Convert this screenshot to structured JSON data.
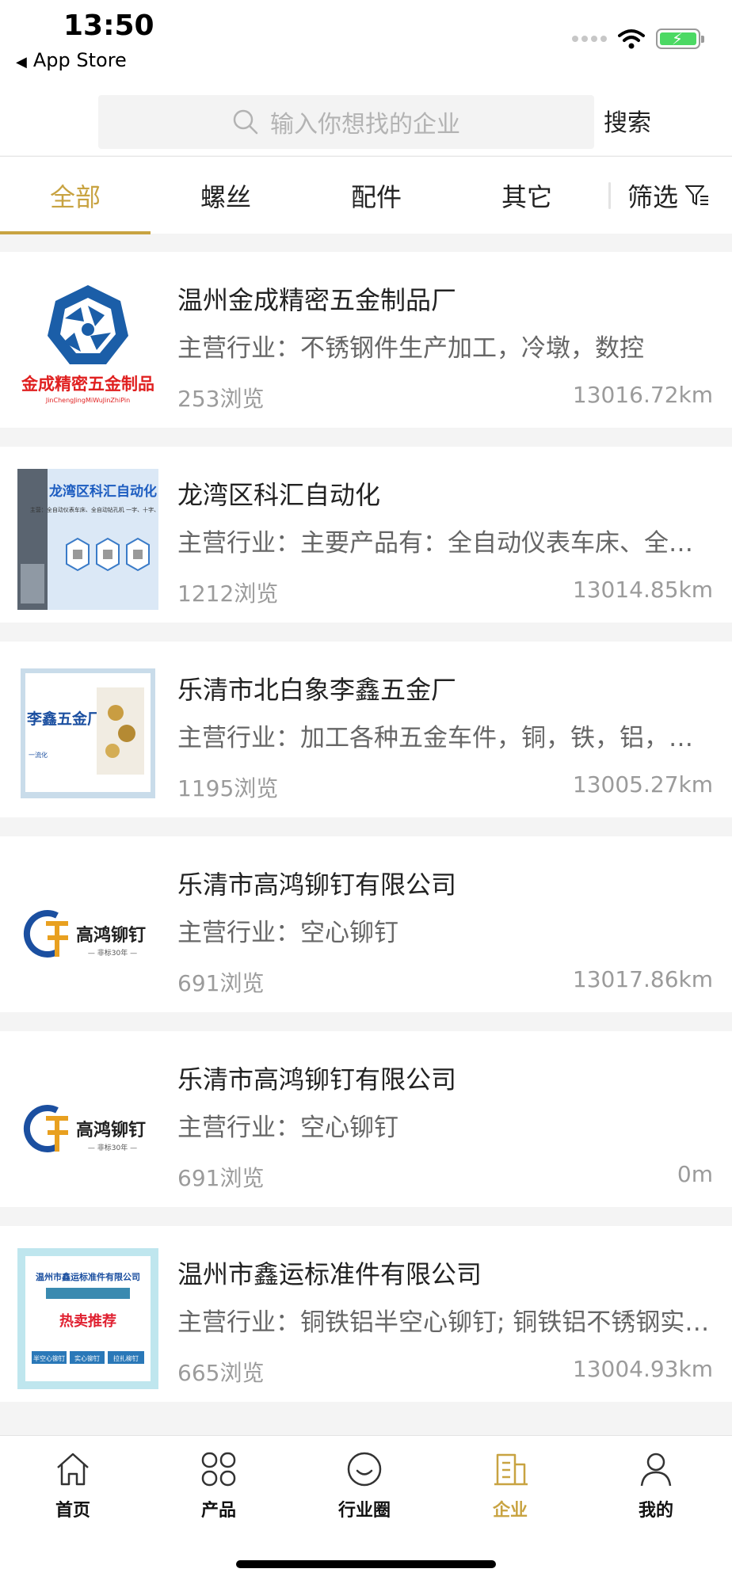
{
  "status_bar": {
    "time": "13:50",
    "back_label": "App Store"
  },
  "search": {
    "placeholder": "输入你想找的企业",
    "button_label": "搜索"
  },
  "tabs": [
    {
      "label": "全部",
      "active": true
    },
    {
      "label": "螺丝",
      "active": false
    },
    {
      "label": "配件",
      "active": false
    },
    {
      "label": "其它",
      "active": false
    }
  ],
  "filter_label": "筛选",
  "companies": [
    {
      "name": "温州金成精密五金制品厂",
      "industry": "主营行业：不锈钢件生产加工，冷墩，数控",
      "views": "253浏览",
      "distance": "13016.72km",
      "logo_text": "金成精密五金制品",
      "logo_sub": "JinChengJingMiWuJinZhiPin"
    },
    {
      "name": "龙湾区科汇自动化",
      "industry": "主营行业：主要产品有：全自动仪表车床、全自动钻孔机",
      "views": "1212浏览",
      "distance": "13014.85km",
      "logo_text": "龙湾区科汇自动化",
      "logo_sub": "主营：全自动仪表车床、全自动钻孔机 一字、十字、铣扁等"
    },
    {
      "name": "乐清市北白象李鑫五金厂",
      "industry": "主营行业：加工各种五金车件，铜，铁，铝，不锈钢",
      "views": "1195浏览",
      "distance": "13005.27km",
      "logo_text": "李鑫五金厂",
      "logo_sub": "一流化"
    },
    {
      "name": "乐清市高鸿铆钉有限公司",
      "industry": "主营行业：空心铆钉",
      "views": "691浏览",
      "distance": "13017.86km",
      "logo_text": "高鸿铆钉",
      "logo_sub": "— 非标30年 —"
    },
    {
      "name": "乐清市高鸿铆钉有限公司",
      "industry": "主营行业：空心铆钉",
      "views": "691浏览",
      "distance": "0m",
      "logo_text": "高鸿铆钉",
      "logo_sub": "— 非标30年 —"
    },
    {
      "name": "温州市鑫运标准件有限公司",
      "industry": "主营行业：铜铁铝半空心铆钉; 铜铁铝不锈钢实心铆钉",
      "views": "665浏览",
      "distance": "13004.93km",
      "logo_text": "温州市鑫运标准件有限公司",
      "logo_sub": "热卖推荐",
      "logo_tags": [
        "半空心铆钉",
        "实心铆钉",
        "拉扎柳钉"
      ]
    }
  ],
  "tabbar": [
    {
      "label": "首页",
      "icon": "home-icon",
      "active": false
    },
    {
      "label": "产品",
      "icon": "grid-icon",
      "active": false
    },
    {
      "label": "行业圈",
      "icon": "smile-icon",
      "active": false
    },
    {
      "label": "企业",
      "icon": "building-icon",
      "active": true
    },
    {
      "label": "我的",
      "icon": "user-icon",
      "active": false
    }
  ],
  "colors": {
    "accent": "#c8a341",
    "background": "#f4f4f4"
  }
}
